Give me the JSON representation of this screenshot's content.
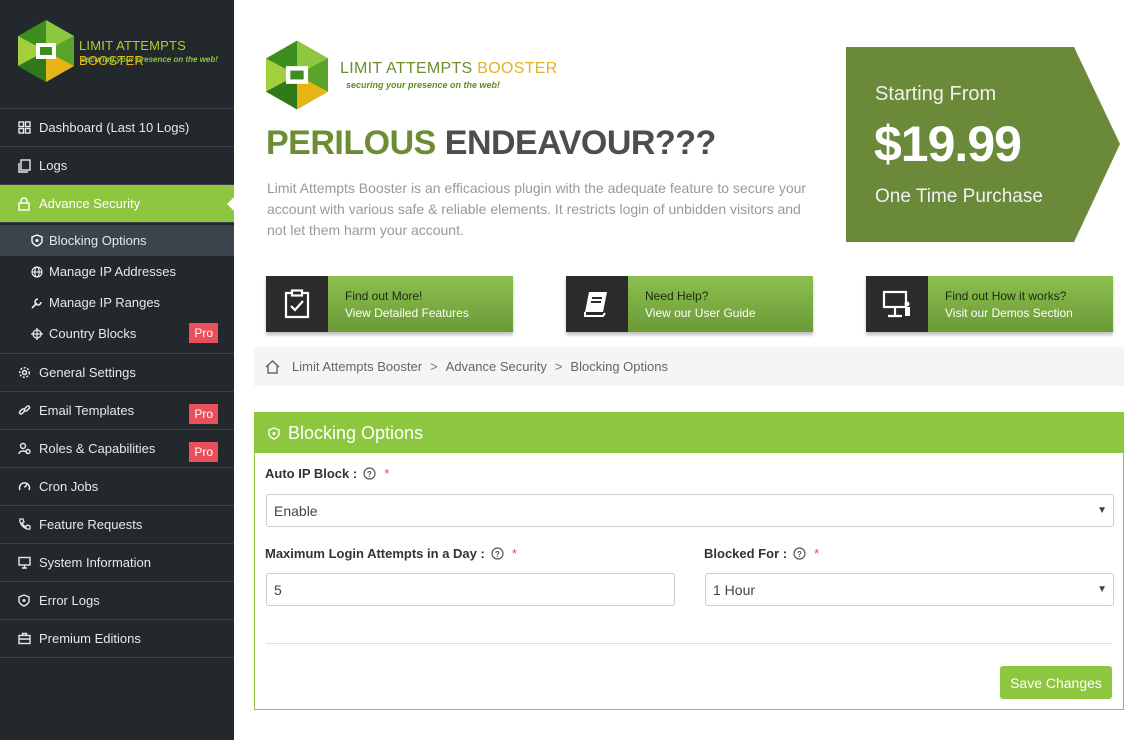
{
  "sidebar": {
    "brand_main": "LIMIT ATTEMPTS ",
    "brand_accent": "BOOSTER",
    "tagline": "securing your presence on the web!",
    "items": [
      {
        "label": "Dashboard (Last 10 Logs)",
        "icon": "dashboard-icon"
      },
      {
        "label": "Logs",
        "icon": "logs-icon"
      },
      {
        "label": "Advance Security",
        "icon": "lock-icon",
        "active": true
      },
      {
        "label": "General Settings",
        "icon": "gear-icon"
      },
      {
        "label": "Email Templates",
        "icon": "link-icon",
        "badge": "Pro"
      },
      {
        "label": "Roles & Capabilities",
        "icon": "users-icon",
        "badge": "Pro"
      },
      {
        "label": "Cron Jobs",
        "icon": "gauge-icon"
      },
      {
        "label": "Feature Requests",
        "icon": "phone-icon"
      },
      {
        "label": "System Information",
        "icon": "monitor-icon"
      },
      {
        "label": "Error Logs",
        "icon": "shield-icon"
      },
      {
        "label": "Premium Editions",
        "icon": "briefcase-icon"
      }
    ],
    "subitems": [
      {
        "label": "Blocking Options",
        "icon": "shield-icon",
        "active": true
      },
      {
        "label": "Manage IP Addresses",
        "icon": "globe-icon"
      },
      {
        "label": "Manage IP Ranges",
        "icon": "wrench-icon"
      },
      {
        "label": "Country Blocks",
        "icon": "crosshair-icon",
        "badge": "Pro"
      }
    ]
  },
  "header": {
    "brand_main": "LIMIT ATTEMPTS ",
    "brand_accent": "BOOSTER",
    "tagline": "securing your presence on the web!",
    "headline_word1": "PERILOUS",
    "headline_word2": "ENDEAVOUR???",
    "intro": "Limit Attempts Booster is an efficacious plugin with the adequate feature to secure your account with various safe & reliable elements. It restricts login of unbidden visitors and not let them harm your account."
  },
  "pricing": {
    "from": "Starting From",
    "price": "$19.99",
    "sub": "One Time Purchase",
    "color": "#6a8a3a"
  },
  "cta": [
    {
      "line1": "Find out More!",
      "line2": "View Detailed Features",
      "icon": "clipboard-check-icon"
    },
    {
      "line1": "Need Help?",
      "line2": "View our User Guide",
      "icon": "book-icon"
    },
    {
      "line1": "Find out How it works?",
      "line2": "Visit our Demos Section",
      "icon": "presentation-icon"
    }
  ],
  "breadcrumb": [
    "Limit Attempts Booster",
    "Advance Security",
    "Blocking Options"
  ],
  "panel": {
    "title": "Blocking Options",
    "auto_ip_label": "Auto IP Block :",
    "auto_ip_value": "Enable",
    "max_attempts_label": "Maximum Login Attempts in a Day :",
    "max_attempts_value": "5",
    "blocked_for_label": "Blocked For :",
    "blocked_for_value": "1 Hour",
    "required_mark": "*",
    "save_label": "Save Changes"
  },
  "colors": {
    "accent": "#8dc63f",
    "sidebar_bg": "#23282d",
    "pro_badge": "#e8505b"
  }
}
